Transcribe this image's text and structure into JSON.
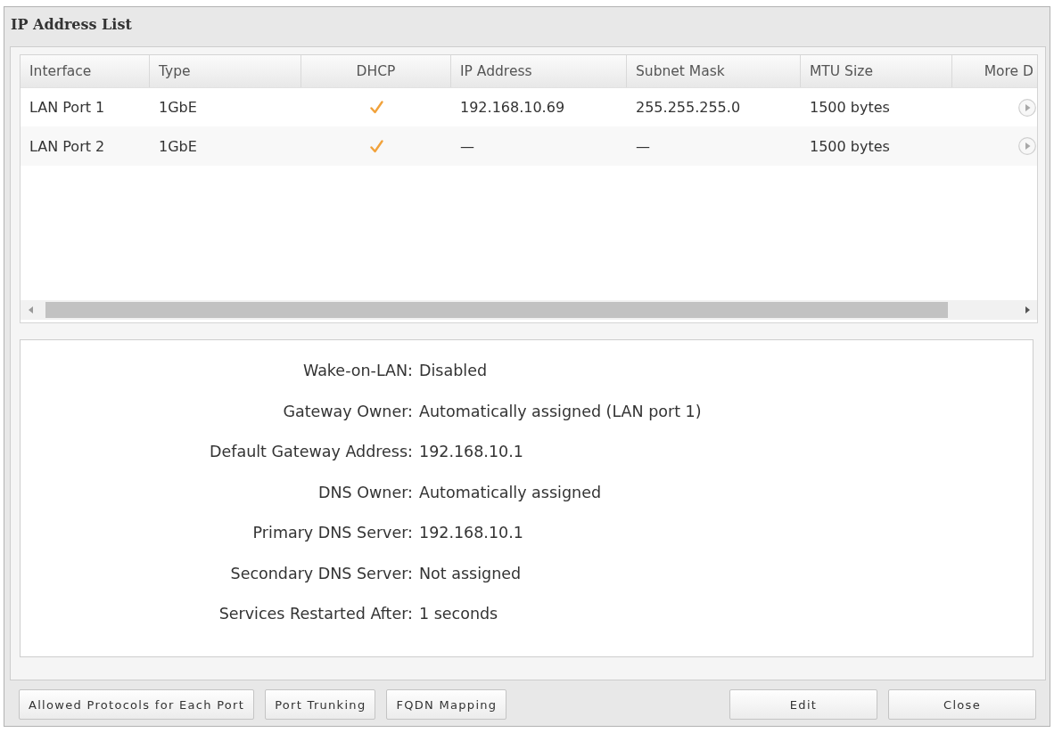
{
  "window": {
    "title": "IP Address List"
  },
  "table": {
    "columns": [
      "Interface",
      "Type",
      "DHCP",
      "IP Address",
      "Subnet Mask",
      "MTU Size",
      "More D"
    ],
    "rows": [
      {
        "interface": "LAN Port 1",
        "type": "1GbE",
        "dhcp": true,
        "ip_address": "192.168.10.69",
        "subnet_mask": "255.255.255.0",
        "mtu_size": "1500 bytes"
      },
      {
        "interface": "LAN Port 2",
        "type": "1GbE",
        "dhcp": true,
        "ip_address": "—",
        "subnet_mask": "—",
        "mtu_size": "1500 bytes"
      }
    ]
  },
  "details": [
    {
      "label": "Wake-on-LAN:",
      "value": "Disabled"
    },
    {
      "label": "Gateway Owner:",
      "value": "Automatically assigned (LAN port 1)"
    },
    {
      "label": "Default Gateway Address:",
      "value": "192.168.10.1"
    },
    {
      "label": "DNS Owner:",
      "value": "Automatically assigned"
    },
    {
      "label": "Primary DNS Server:",
      "value": "192.168.10.1"
    },
    {
      "label": "Secondary DNS Server:",
      "value": "Not assigned"
    },
    {
      "label": "Services Restarted After:",
      "value": "1 seconds"
    }
  ],
  "buttons": {
    "left": [
      "Allowed Protocols for Each Port",
      "Port Trunking",
      "FQDN Mapping"
    ],
    "right": [
      "Edit",
      "Close"
    ]
  }
}
